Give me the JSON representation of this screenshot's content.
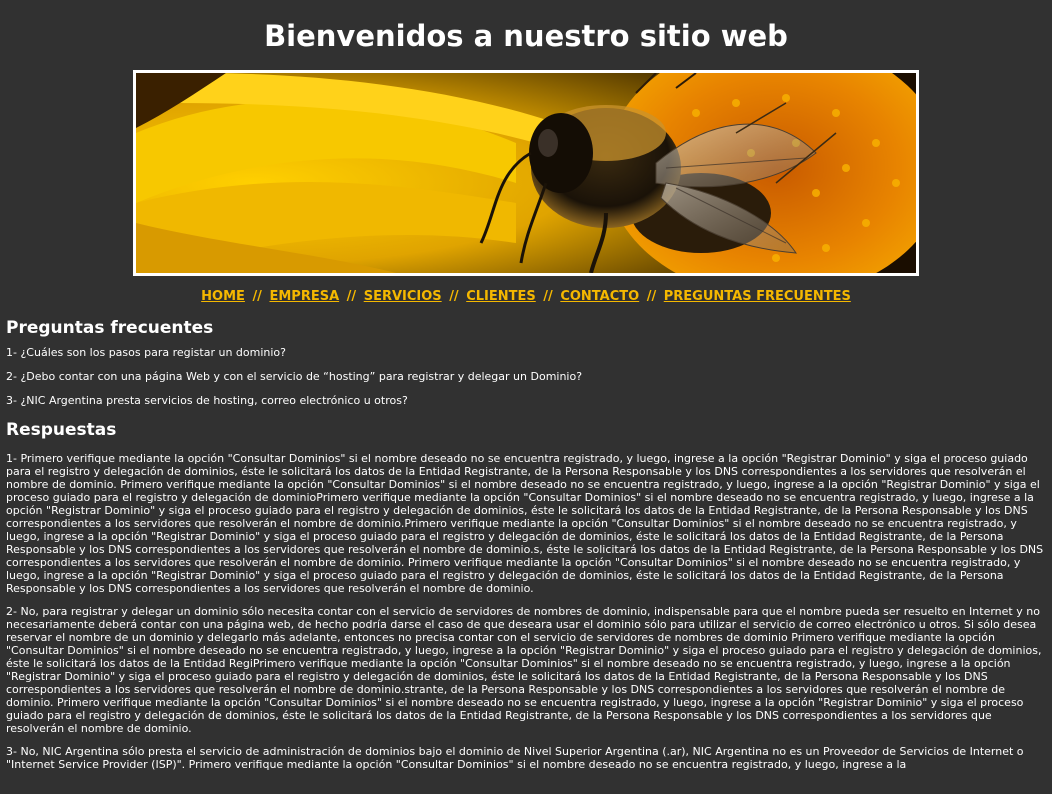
{
  "header": {
    "title": "Bienvenidos a nuestro sitio web"
  },
  "banner": {
    "icon": "bee-on-flower-photo",
    "colors": {
      "petal": "#f5c400",
      "center": "#e07a00",
      "bee_body": "#1c1409",
      "bee_fur": "#c98f2a"
    }
  },
  "nav": {
    "items": [
      {
        "label": "HOME"
      },
      {
        "label": "EMPRESA"
      },
      {
        "label": "SERVICIOS"
      },
      {
        "label": "CLIENTES"
      },
      {
        "label": "CONTACTO"
      },
      {
        "label": "PREGUNTAS FRECUENTES"
      }
    ],
    "separator": "//"
  },
  "faq": {
    "heading": "Preguntas frecuentes",
    "questions": [
      "1- ¿Cuáles son los pasos para registar un dominio?",
      "2- ¿Debo contar con una página Web y con el servicio de “hosting” para registrar y delegar un Dominio?",
      "3- ¿NIC Argentina presta servicios de hosting, correo electrónico u otros?"
    ]
  },
  "answers": {
    "heading": "Respuestas",
    "items": [
      "1- Primero verifique mediante la opción \"Consultar Dominios\" si el nombre deseado no se encuentra registrado, y luego, ingrese a la opción \"Registrar Dominio\" y siga el proceso guiado para el registro y delegación de dominios, éste le solicitará los datos de la Entidad Registrante, de la Persona Responsable y los DNS correspondientes a los servidores que resolverán el nombre de dominio. Primero verifique mediante la opción \"Consultar Dominios\" si el nombre deseado no se encuentra registrado, y luego, ingrese a la opción \"Registrar Dominio\" y siga el proceso guiado para el registro y delegación de dominioPrimero verifique mediante la opción \"Consultar Dominios\" si el nombre deseado no se encuentra registrado, y luego, ingrese a la opción \"Registrar Dominio\" y siga el proceso guiado para el registro y delegación de dominios, éste le solicitará los datos de la Entidad Registrante, de la Persona Responsable y los DNS correspondientes a los servidores que resolverán el nombre de dominio.Primero verifique mediante la opción \"Consultar Dominios\" si el nombre deseado no se encuentra registrado, y luego, ingrese a la opción \"Registrar Dominio\" y siga el proceso guiado para el registro y delegación de dominios, éste le solicitará los datos de la Entidad Registrante, de la Persona Responsable y los DNS correspondientes a los servidores que resolverán el nombre de dominio.s, éste le solicitará los datos de la Entidad Registrante, de la Persona Responsable y los DNS correspondientes a los servidores que resolverán el nombre de dominio. Primero verifique mediante la opción \"Consultar Dominios\" si el nombre deseado no se encuentra registrado, y luego, ingrese a la opción \"Registrar Dominio\" y siga el proceso guiado para el registro y delegación de dominios, éste le solicitará los datos de la Entidad Registrante, de la Persona Responsable y los DNS correspondientes a los servidores que resolverán el nombre de dominio.",
      "2- No, para registrar y delegar un dominio sólo necesita contar con el servicio de servidores de nombres de dominio, indispensable para que el nombre pueda ser resuelto en Internet y no necesariamente deberá contar con una página web, de hecho podría darse el caso de que deseara usar el dominio sólo para utilizar el servicio de correo electrónico u otros. Si sólo desea reservar el nombre de un dominio y delegarlo más adelante, entonces no precisa contar con el servicio de servidores de nombres de dominio Primero verifique mediante la opción \"Consultar Dominios\" si el nombre deseado no se encuentra registrado, y luego, ingrese a la opción \"Registrar Dominio\" y siga el proceso guiado para el registro y delegación de dominios, éste le solicitará los datos de la Entidad RegiPrimero verifique mediante la opción \"Consultar Dominios\" si el nombre deseado no se encuentra registrado, y luego, ingrese a la opción \"Registrar Dominio\" y siga el proceso guiado para el registro y delegación de dominios, éste le solicitará los datos de la Entidad Registrante, de la Persona Responsable y los DNS correspondientes a los servidores que resolverán el nombre de dominio.strante, de la Persona Responsable y los DNS correspondientes a los servidores que resolverán el nombre de dominio. Primero verifique mediante la opción \"Consultar Dominios\" si el nombre deseado no se encuentra registrado, y luego, ingrese a la opción \"Registrar Dominio\" y siga el proceso guiado para el registro y delegación de dominios, éste le solicitará los datos de la Entidad Registrante, de la Persona Responsable y los DNS correspondientes a los servidores que resolverán el nombre de dominio.",
      "3- No, NIC Argentina sólo presta el servicio de administración de dominios bajo el dominio de Nivel Superior Argentina (.ar), NIC Argentina no es un Proveedor de Servicios de Internet o \"Internet Service Provider (ISP)\". Primero verifique mediante la opción \"Consultar Dominios\" si el nombre deseado no se encuentra registrado, y luego, ingrese a la"
    ]
  }
}
